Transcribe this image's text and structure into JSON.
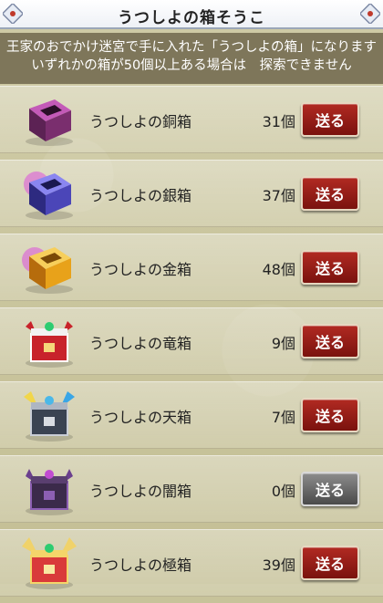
{
  "header": {
    "title": "うつしよの箱そうこ"
  },
  "info": {
    "line1": "王家のおでかけ迷宮で手に入れた「うつしよの箱」になります",
    "line2": "いずれかの箱が50個以上ある場合は　探索できません"
  },
  "items": [
    {
      "name": "うつしよの銅箱",
      "count": "31個",
      "send_label": "送る",
      "enabled": true,
      "color": "#7a2e6e"
    },
    {
      "name": "うつしよの銀箱",
      "count": "37個",
      "send_label": "送る",
      "enabled": true,
      "color": "#4b46b8"
    },
    {
      "name": "うつしよの金箱",
      "count": "48個",
      "send_label": "送る",
      "enabled": true,
      "color": "#e8a21a"
    },
    {
      "name": "うつしよの竜箱",
      "count": "9個",
      "send_label": "送る",
      "enabled": true,
      "color": "#c8232b"
    },
    {
      "name": "うつしよの天箱",
      "count": "7個",
      "send_label": "送る",
      "enabled": true,
      "color": "#3a4352"
    },
    {
      "name": "うつしよの闇箱",
      "count": "0個",
      "send_label": "送る",
      "enabled": false,
      "color": "#3b2a4a"
    },
    {
      "name": "うつしよの極箱",
      "count": "39個",
      "send_label": "送る",
      "enabled": true,
      "color": "#d93a3a"
    }
  ],
  "icons": {
    "corner": "ornament-icon",
    "box": "treasure-box-icon"
  }
}
